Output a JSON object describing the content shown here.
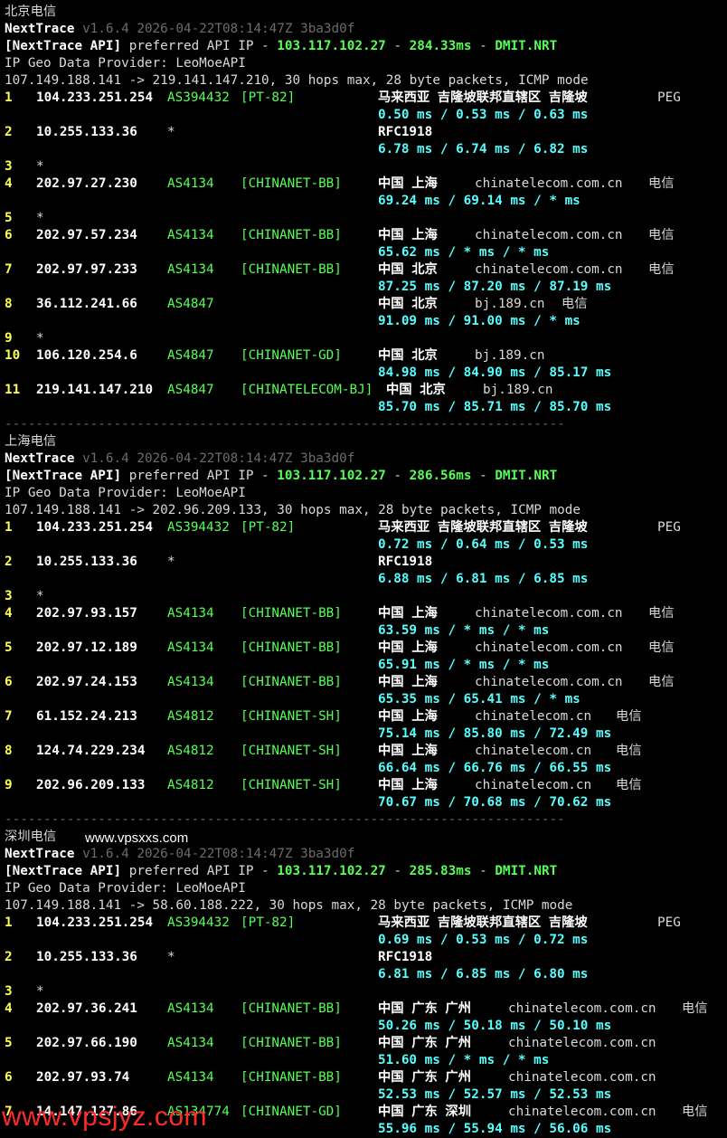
{
  "watermarks": {
    "site": "www.vpsxxs.com",
    "red": "www.vpsjyz.com"
  },
  "separator": "------------------------------------------------------------------------",
  "sections": [
    {
      "title": "北京电信",
      "app": "NextTrace",
      "version": "v1.6.4 2026-04-22T08:14:47Z 3ba3d0f",
      "api_prefix": "[NextTrace API]",
      "api_text": " preferred API IP - ",
      "api_ip": "103.117.102.27",
      "api_dash": " - ",
      "api_ms": "284.33ms",
      "api_node": "DMIT.NRT",
      "geo_provider": "IP Geo Data Provider: LeoMoeAPI",
      "trace_line": "107.149.188.141 -> 219.141.147.210, 30 hops max, 28 byte packets, ICMP mode",
      "hops": [
        {
          "n": "1",
          "ip": "104.233.251.254",
          "asn": "AS394432",
          "tag": "[PT-82]",
          "geo": "马来西亚 吉隆坡联邦直辖区 吉隆坡",
          "host": "PEG",
          "isp": "",
          "rtt": "0.50 ms / 0.53 ms / 0.63 ms"
        },
        {
          "n": "2",
          "ip": "10.255.133.36",
          "asn": "*",
          "tag": "",
          "geo": "RFC1918",
          "host": "",
          "isp": "",
          "rtt": "6.78 ms / 6.74 ms / 6.82 ms"
        },
        {
          "n": "3",
          "ip": "*"
        },
        {
          "n": "4",
          "ip": "202.97.27.230",
          "asn": "AS4134",
          "tag": "[CHINANET-BB]",
          "geo": "中国 上海",
          "host": "chinatelecom.com.cn",
          "isp": "电信",
          "rtt": "69.24 ms / 69.14 ms / * ms"
        },
        {
          "n": "5",
          "ip": "*"
        },
        {
          "n": "6",
          "ip": "202.97.57.234",
          "asn": "AS4134",
          "tag": "[CHINANET-BB]",
          "geo": "中国 上海",
          "host": "chinatelecom.com.cn",
          "isp": "电信",
          "rtt": "65.62 ms / * ms / * ms"
        },
        {
          "n": "7",
          "ip": "202.97.97.233",
          "asn": "AS4134",
          "tag": "[CHINANET-BB]",
          "geo": "中国 北京",
          "host": "chinatelecom.com.cn",
          "isp": "电信",
          "rtt": "87.25 ms / 87.20 ms / 87.19 ms"
        },
        {
          "n": "8",
          "ip": "36.112.241.66",
          "asn": "AS4847",
          "tag": "",
          "geo": "中国 北京",
          "host": "bj.189.cn",
          "isp": "电信",
          "rtt": "91.09 ms / 91.00 ms / * ms"
        },
        {
          "n": "9",
          "ip": "*"
        },
        {
          "n": "10",
          "ip": "106.120.254.6",
          "asn": "AS4847",
          "tag": "[CHINANET-GD]",
          "geo": "中国 北京",
          "host": "bj.189.cn",
          "isp": "",
          "rtt": "84.98 ms / 84.90 ms / 85.17 ms"
        },
        {
          "n": "11",
          "ip": "219.141.147.210",
          "asn": "AS4847",
          "tag": "[CHINATELECOM-BJ]",
          "geo": "中国 北京",
          "host": "bj.189.cn",
          "isp": "",
          "rtt": "85.70 ms / 85.71 ms / 85.70 ms",
          "wide": true
        }
      ]
    },
    {
      "title": "上海电信",
      "app": "NextTrace",
      "version": "v1.6.4 2026-04-22T08:14:47Z 3ba3d0f",
      "api_prefix": "[NextTrace API]",
      "api_text": " preferred API IP - ",
      "api_ip": "103.117.102.27",
      "api_dash": " - ",
      "api_ms": "286.56ms",
      "api_node": "DMIT.NRT",
      "geo_provider": "IP Geo Data Provider: LeoMoeAPI",
      "trace_line": "107.149.188.141 -> 202.96.209.133, 30 hops max, 28 byte packets, ICMP mode",
      "hops": [
        {
          "n": "1",
          "ip": "104.233.251.254",
          "asn": "AS394432",
          "tag": "[PT-82]",
          "geo": "马来西亚 吉隆坡联邦直辖区 吉隆坡",
          "host": "PEG",
          "isp": "",
          "rtt": "0.72 ms / 0.64 ms / 0.53 ms"
        },
        {
          "n": "2",
          "ip": "10.255.133.36",
          "asn": "*",
          "tag": "",
          "geo": "RFC1918",
          "host": "",
          "isp": "",
          "rtt": "6.88 ms / 6.81 ms / 6.85 ms"
        },
        {
          "n": "3",
          "ip": "*"
        },
        {
          "n": "4",
          "ip": "202.97.93.157",
          "asn": "AS4134",
          "tag": "[CHINANET-BB]",
          "geo": "中国 上海",
          "host": "chinatelecom.com.cn",
          "isp": "电信",
          "rtt": "63.59 ms / * ms / * ms"
        },
        {
          "n": "5",
          "ip": "202.97.12.189",
          "asn": "AS4134",
          "tag": "[CHINANET-BB]",
          "geo": "中国 上海",
          "host": "chinatelecom.com.cn",
          "isp": "电信",
          "rtt": "65.91 ms / * ms / * ms"
        },
        {
          "n": "6",
          "ip": "202.97.24.153",
          "asn": "AS4134",
          "tag": "[CHINANET-BB]",
          "geo": "中国 上海",
          "host": "chinatelecom.com.cn",
          "isp": "电信",
          "rtt": "65.35 ms / 65.41 ms / * ms"
        },
        {
          "n": "7",
          "ip": "61.152.24.213",
          "asn": "AS4812",
          "tag": "[CHINANET-SH]",
          "geo": "中国 上海",
          "host": "chinatelecom.cn",
          "isp": "电信",
          "rtt": "75.14 ms / 85.80 ms / 72.49 ms"
        },
        {
          "n": "8",
          "ip": "124.74.229.234",
          "asn": "AS4812",
          "tag": "[CHINANET-SH]",
          "geo": "中国 上海",
          "host": "chinatelecom.cn",
          "isp": "电信",
          "rtt": "66.64 ms / 66.76 ms / 66.55 ms"
        },
        {
          "n": "9",
          "ip": "202.96.209.133",
          "asn": "AS4812",
          "tag": "[CHINANET-SH]",
          "geo": "中国 上海",
          "host": "chinatelecom.cn",
          "isp": "电信",
          "rtt": "70.67 ms / 70.68 ms / 70.62 ms"
        }
      ]
    },
    {
      "title": "深圳电信",
      "app": "NextTrace",
      "version": "v1.6.4 2026-04-22T08:14:47Z 3ba3d0f",
      "api_prefix": "[NextTrace API]",
      "api_text": " preferred API IP - ",
      "api_ip": "103.117.102.27",
      "api_dash": " - ",
      "api_ms": "285.83ms",
      "api_node": "DMIT.NRT",
      "geo_provider": "IP Geo Data Provider: LeoMoeAPI",
      "trace_line": "107.149.188.141 -> 58.60.188.222, 30 hops max, 28 byte packets, ICMP mode",
      "hops": [
        {
          "n": "1",
          "ip": "104.233.251.254",
          "asn": "AS394432",
          "tag": "[PT-82]",
          "geo": "马来西亚 吉隆坡联邦直辖区 吉隆坡",
          "host": "PEG",
          "isp": "",
          "rtt": "0.69 ms / 0.53 ms / 0.72 ms"
        },
        {
          "n": "2",
          "ip": "10.255.133.36",
          "asn": "*",
          "tag": "",
          "geo": "RFC1918",
          "host": "",
          "isp": "",
          "rtt": "6.81 ms / 6.85 ms / 6.80 ms"
        },
        {
          "n": "3",
          "ip": "*"
        },
        {
          "n": "4",
          "ip": "202.97.36.241",
          "asn": "AS4134",
          "tag": "[CHINANET-BB]",
          "geo": "中国 广东 广州",
          "host": "chinatelecom.com.cn",
          "isp": "电信",
          "rtt": "50.26 ms / 50.18 ms / 50.10 ms"
        },
        {
          "n": "5",
          "ip": "202.97.66.190",
          "asn": "AS4134",
          "tag": "[CHINANET-BB]",
          "geo": "中国 广东 广州",
          "host": "chinatelecom.com.cn",
          "isp": "",
          "rtt": "51.60 ms / * ms / * ms"
        },
        {
          "n": "6",
          "ip": "202.97.93.74",
          "asn": "AS4134",
          "tag": "[CHINANET-BB]",
          "geo": "中国 广东 广州",
          "host": "chinatelecom.com.cn",
          "isp": "",
          "rtt": "52.53 ms / 52.57 ms / 52.53 ms"
        },
        {
          "n": "7",
          "ip": "14.147.127.86",
          "asn": "AS134774",
          "tag": "[CHINANET-GD]",
          "geo": "中国 广东 深圳",
          "host": "chinatelecom.com.cn",
          "isp": "电信",
          "rtt": "55.96 ms / 55.94 ms / 56.06 ms"
        }
      ]
    }
  ]
}
